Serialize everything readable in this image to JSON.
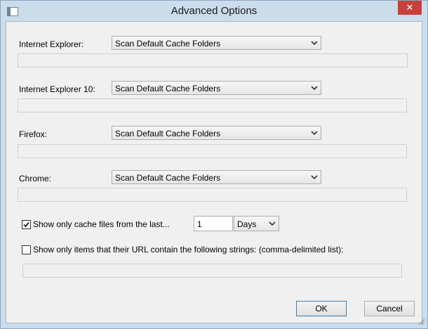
{
  "window": {
    "title": "Advanced Options",
    "close_glyph": "✕"
  },
  "browsers": [
    {
      "label": "Internet Explorer:",
      "selected": "Scan Default Cache Folders",
      "path": ""
    },
    {
      "label": "Internet Explorer 10:",
      "selected": "Scan Default Cache Folders",
      "path": ""
    },
    {
      "label": "Firefox:",
      "selected": "Scan Default Cache Folders",
      "path": ""
    },
    {
      "label": "Chrome:",
      "selected": "Scan Default Cache Folders",
      "path": ""
    }
  ],
  "filters": {
    "last_files": {
      "label": "Show only cache files from the last...",
      "checked": true,
      "amount": "1",
      "unit": "Days"
    },
    "url_filter": {
      "label": "Show only items that their URL contain the following strings: (comma-delimited list):",
      "checked": false,
      "value": ""
    }
  },
  "buttons": {
    "ok": "OK",
    "cancel": "Cancel"
  }
}
